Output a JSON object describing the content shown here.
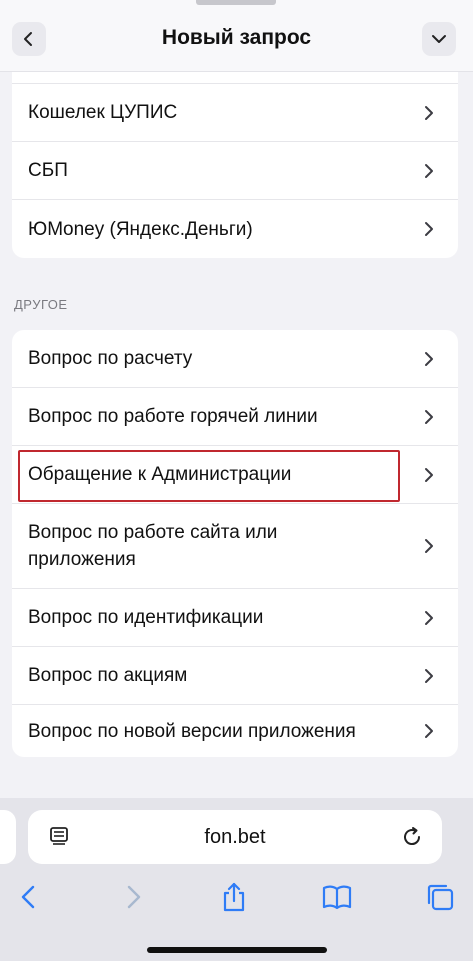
{
  "header": {
    "title": "Новый запрос",
    "back_icon": "chevron-left-icon",
    "collapse_icon": "chevron-down-icon"
  },
  "payments": {
    "items": [
      {
        "label": "Кошелек ЦУПИС"
      },
      {
        "label": "СБП"
      },
      {
        "label": "ЮMoney (Яндекс.Деньги)"
      }
    ]
  },
  "other": {
    "section_label": "ДРУГОЕ",
    "items": [
      {
        "label": "Вопрос по расчету"
      },
      {
        "label": "Вопрос по работе горячей линии"
      },
      {
        "label": "Обращение к Администрации",
        "highlighted": true
      },
      {
        "label": "Вопрос по работе сайта или приложения"
      },
      {
        "label": "Вопрос по идентификации"
      },
      {
        "label": "Вопрос по акциям"
      },
      {
        "label": "Вопрос по новой версии приложения"
      }
    ]
  },
  "browser": {
    "url": "fon.bet",
    "reader_icon": "reader-mode-icon",
    "reload_icon": "reload-icon",
    "toolbar_icons": [
      "back-icon",
      "forward-icon",
      "share-icon",
      "bookmarks-icon",
      "tabs-icon"
    ]
  },
  "colors": {
    "accent": "#2f7cf6",
    "highlight": "#c0282f",
    "background": "#f2f2f6"
  }
}
